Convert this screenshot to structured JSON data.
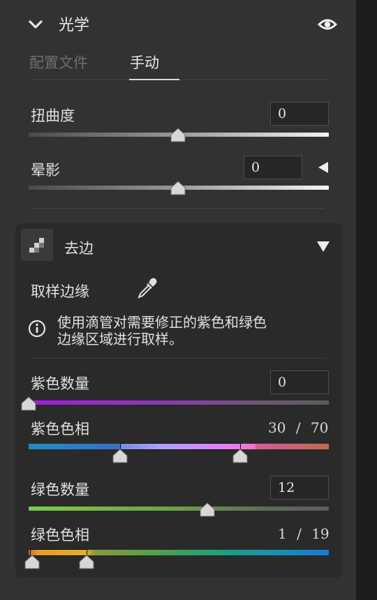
{
  "section": {
    "title": "光学"
  },
  "tabs": [
    {
      "label": "配置文件",
      "active": false
    },
    {
      "label": "手动",
      "active": true
    }
  ],
  "distortion": {
    "label": "扭曲度",
    "value": "0",
    "level": 0.5
  },
  "vignette": {
    "label": "晕影",
    "value": "0",
    "level": 0.5
  },
  "defringe": {
    "title": "去边",
    "sample_label": "取样边缘",
    "info_text": "使用滴管对需要修正的紫色和绿色边缘区域进行取样。",
    "info_line1": "使用滴管对需要修正的紫色和绿色",
    "info_line2": "边缘区域进行取样。",
    "purple_amount": {
      "label": "紫色数量",
      "value": "0",
      "level": 0
    },
    "purple_hue": {
      "label": "紫色色相",
      "low": "30",
      "high": "70",
      "sep": "/"
    },
    "green_amount": {
      "label": "绿色数量",
      "value": "12",
      "level": 0.6
    },
    "green_hue": {
      "label": "绿色色相",
      "low": "1",
      "high": "19",
      "sep": "/"
    }
  },
  "icons": {
    "chevron": "chevron-down-icon",
    "visibility": "eye-icon",
    "vignette_menu": "triangle-left-icon",
    "defringe": "defringe-icon",
    "collapse": "triangle-down-icon",
    "eyedropper": "eyedropper-icon",
    "info": "info-icon"
  },
  "colors": {
    "accent_tab_underline": "#d8d8d8",
    "panel_bg": "#323232",
    "card_bg": "#2a2a2a"
  }
}
